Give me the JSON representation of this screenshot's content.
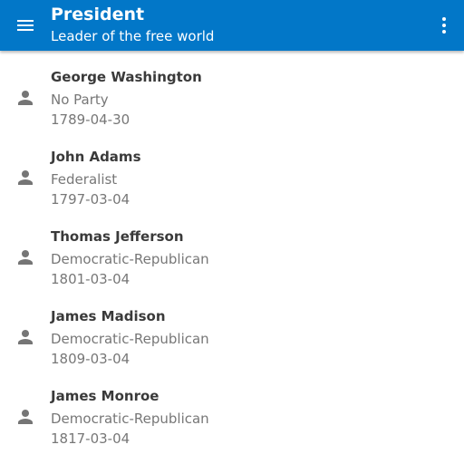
{
  "appbar": {
    "title": "President",
    "subtitle": "Leader of the free world",
    "menu_icon": "menu-icon",
    "more_icon": "more-vert-icon",
    "color": "#0277c8"
  },
  "presidents": [
    {
      "name": "George Washington",
      "party": "No Party",
      "date": "1789-04-30",
      "icon": "person-icon"
    },
    {
      "name": "John Adams",
      "party": "Federalist",
      "date": "1797-03-04",
      "icon": "person-icon"
    },
    {
      "name": "Thomas Jefferson",
      "party": "Democratic-Republican",
      "date": "1801-03-04",
      "icon": "person-icon"
    },
    {
      "name": "James Madison",
      "party": "Democratic-Republican",
      "date": "1809-03-04",
      "icon": "person-icon"
    },
    {
      "name": "James Monroe",
      "party": "Democratic-Republican",
      "date": "1817-03-04",
      "icon": "person-icon"
    }
  ]
}
